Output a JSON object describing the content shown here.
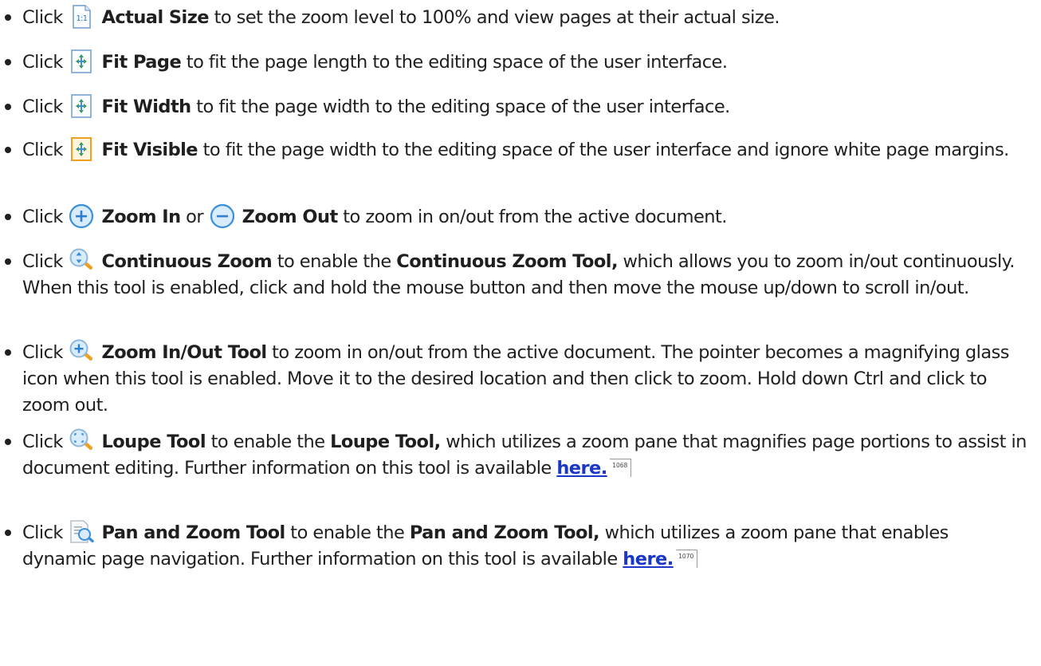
{
  "items": [
    {
      "click": "Click",
      "icon": "actual-size-icon",
      "label": "Actual Size",
      "text": " to set the zoom level to 100% and view pages at their actual size."
    },
    {
      "click": "Click",
      "icon": "fit-page-icon",
      "label": "Fit Page",
      "text": "  to fit the page length to the editing space of the user interface."
    },
    {
      "click": "Click",
      "icon": "fit-width-icon",
      "label": "Fit Width",
      "text": "  to fit the page width to the editing space of the user interface."
    },
    {
      "click": "Click",
      "icon": "fit-visible-icon",
      "label": "Fit Visible",
      "text": "  to fit the page width to the editing space of the user interface and ignore white page margins."
    },
    {
      "click": "Click",
      "icon": "zoom-in-icon",
      "label": "Zoom In",
      "or": " or ",
      "icon2": "zoom-out-icon",
      "label2": "Zoom Out",
      "text": " to zoom in on/out from the active document."
    },
    {
      "click": "Click",
      "icon": "continuous-zoom-icon",
      "label": "Continuous Zoom",
      "text_a": " to enable the ",
      "label_b": "Continuous Zoom Tool,",
      "text": " which allows you to zoom in/out continuously. When this tool is enabled, click and hold the mouse button and then move the mouse up/down to scroll in/out."
    },
    {
      "click": "Click",
      "icon": "zoom-in-out-tool-icon",
      "label": "Zoom In/Out Tool",
      "text": " to zoom in on/out from the active document. The pointer becomes a magnifying glass icon when this tool is enabled. Move it to the desired location and then click to zoom. Hold down Ctrl and click to zoom out."
    },
    {
      "click": "Click",
      "icon": "loupe-tool-icon",
      "label": "Loupe Tool",
      "text_a": " to enable the ",
      "label_b": "Loupe Tool,",
      "text": " which utilizes a zoom pane that magnifies page portions to assist in document editing. Further information on this tool is available ",
      "link": "here.",
      "page_ref": "1068"
    },
    {
      "click": "Click",
      "icon": "pan-and-zoom-tool-icon",
      "label": "Pan and Zoom Tool",
      "text_a": " to enable the ",
      "label_b": "Pan and Zoom Tool,",
      "text": " which utilizes a zoom pane that enables dynamic page navigation. Further information on this tool is available ",
      "link": "here.",
      "page_ref": "1070"
    }
  ],
  "colors": {
    "text": "#1f1f1f",
    "link": "#1a37c8",
    "icon_blue": "#3a8fd8",
    "icon_orange": "#f0a020"
  }
}
